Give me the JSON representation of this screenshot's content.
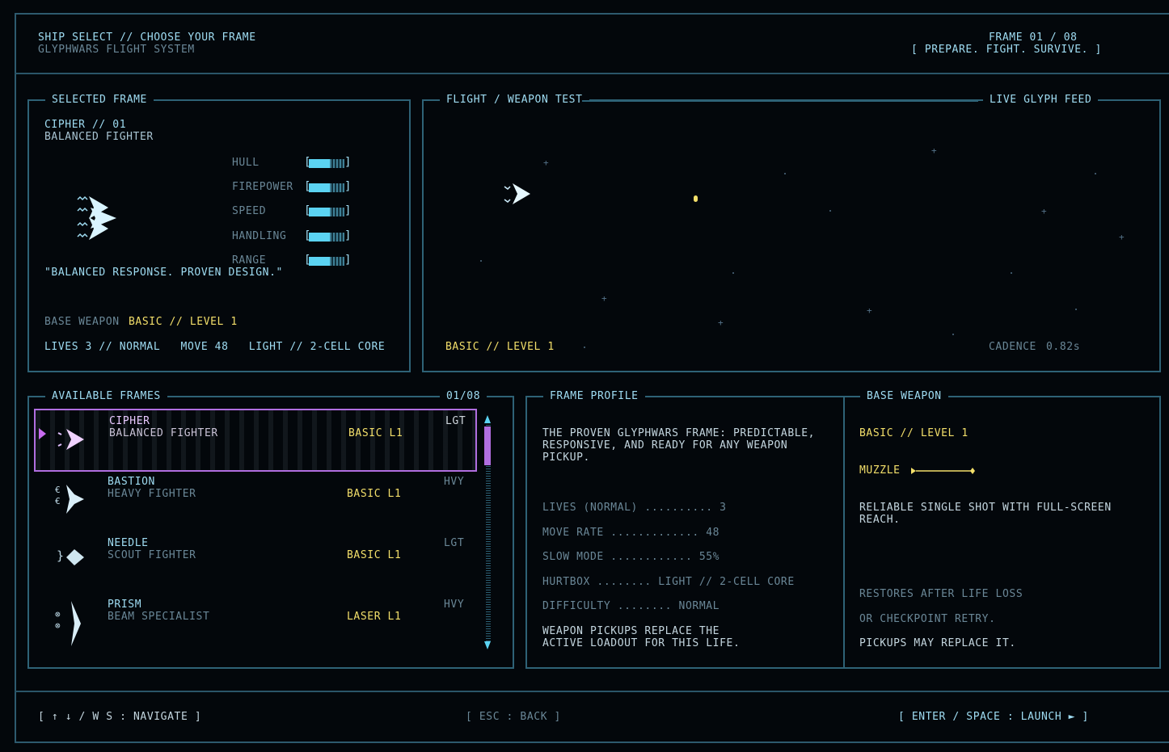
{
  "header": {
    "title": "SHIP SELECT // CHOOSE YOUR FRAME",
    "subtitle": "GLYPHWARS FLIGHT SYSTEM",
    "frame_counter": "FRAME 01 / 08",
    "tagline": "[ PREPARE. FIGHT. SURVIVE. ]"
  },
  "selected": {
    "panel_title": "SELECTED FRAME",
    "name": "CIPHER // 01",
    "class": "BALANCED FIGHTER",
    "stats": [
      {
        "label": "HULL",
        "level": 0.6
      },
      {
        "label": "FIREPOWER",
        "level": 0.6
      },
      {
        "label": "SPEED",
        "level": 0.6
      },
      {
        "label": "HANDLING",
        "level": 0.6
      },
      {
        "label": "RANGE",
        "level": 0.6
      }
    ],
    "quote": "\"BALANCED RESPONSE. PROVEN DESIGN.\"",
    "base_weapon_label": "BASE WEAPON",
    "base_weapon_value": "BASIC // LEVEL 1",
    "summary": "LIVES 3 // NORMAL   MOVE 48   LIGHT // 2-CELL CORE"
  },
  "test": {
    "panel_title": "FLIGHT / WEAPON TEST",
    "feed_label": "LIVE GLYPH FEED",
    "weapon": "BASIC // LEVEL 1",
    "cadence_label": "CADENCE",
    "cadence_value": "0.82s"
  },
  "frames": {
    "panel_title": "AVAILABLE FRAMES",
    "counter": "01/08",
    "items": [
      {
        "name": "CIPHER",
        "class": "BALANCED FIGHTER",
        "weapon": "BASIC L1",
        "weight": "LGT"
      },
      {
        "name": "BASTION",
        "class": "HEAVY FIGHTER",
        "weapon": "BASIC L1",
        "weight": "HVY"
      },
      {
        "name": "NEEDLE",
        "class": "SCOUT FIGHTER",
        "weapon": "BASIC L1",
        "weight": "LGT"
      },
      {
        "name": "PRISM",
        "class": "BEAM SPECIALIST",
        "weapon": "LASER L1",
        "weight": "HVY"
      }
    ],
    "bastion_glyph": "€\n€",
    "needle_glyph": "}",
    "prism_glyph": "⊗\n⊗"
  },
  "profile": {
    "panel_title": "FRAME PROFILE",
    "description": "THE PROVEN GLYPHWARS FRAME: PREDICTABLE,\nRESPONSIVE, AND READY FOR ANY WEAPON\nPICKUP.",
    "lines": [
      "LIVES (NORMAL) .......... 3",
      "MOVE RATE ............. 48",
      "SLOW MODE ............ 55%",
      "HURTBOX ........ LIGHT // 2-CELL CORE",
      "DIFFICULTY ........ NORMAL"
    ],
    "note": "WEAPON PICKUPS REPLACE THE\nACTIVE LOADOUT FOR THIS LIFE."
  },
  "weapon": {
    "panel_title": "BASE WEAPON",
    "name": "BASIC // LEVEL 1",
    "muzzle_label": "MUZZLE",
    "description": "RELIABLE SINGLE SHOT WITH FULL-SCREEN\nREACH.",
    "restore_1": "RESTORES AFTER LIFE LOSS",
    "restore_2": "OR CHECKPOINT RETRY.",
    "restore_3": "PICKUPS MAY REPLACE IT."
  },
  "footer": {
    "navigate": "[ ↑ ↓ / W S : NAVIGATE ]",
    "back": "[ ESC : BACK ]",
    "launch": "[ ENTER / SPACE : LAUNCH ► ]"
  },
  "colors": {
    "accent": "#9fdcf2",
    "highlight": "#f3df6a",
    "selection": "#b06ee0",
    "border": "#2e6276"
  }
}
